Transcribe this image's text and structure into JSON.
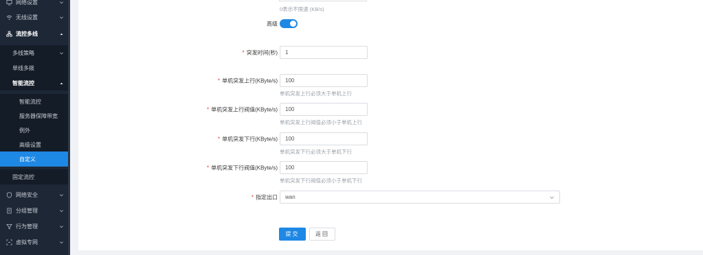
{
  "sidebar": {
    "items": [
      {
        "label": "网络设置",
        "icon": "monitor-icon"
      },
      {
        "label": "无线设置",
        "icon": "wifi-icon"
      },
      {
        "label": "流控多线",
        "icon": "network-icon"
      },
      {
        "label": "多线策略"
      },
      {
        "label": "单线多拨"
      },
      {
        "label": "智能流控"
      },
      {
        "label": "智能流控"
      },
      {
        "label": "服务器保障带宽"
      },
      {
        "label": "例外"
      },
      {
        "label": "高级设置"
      },
      {
        "label": "自定义"
      },
      {
        "label": "固定流控"
      },
      {
        "label": "网络安全",
        "icon": "shield-icon"
      },
      {
        "label": "分组管理",
        "icon": "document-icon"
      },
      {
        "label": "行为管理",
        "icon": "filter-icon"
      },
      {
        "label": "虚拟专网",
        "icon": "vpn-icon"
      }
    ]
  },
  "form": {
    "top_hint": "0表示不限速 (KB/s)",
    "advanced_label": "高级",
    "fields": [
      {
        "label": "突发时间(秒)",
        "value": "1",
        "hint": ""
      },
      {
        "label": "单机突发上行(KByte/s)",
        "value": "100",
        "hint": "单机突发上行必须大于单机上行"
      },
      {
        "label": "单机突发上行阀值(KByte/s)",
        "value": "100",
        "hint": "单机突发上行阀值必须小于单机上行"
      },
      {
        "label": "单机突发下行(KByte/s)",
        "value": "100",
        "hint": "单机突发下行必须大于单机下行"
      },
      {
        "label": "单机突发下行阀值(KByte/s)",
        "value": "100",
        "hint": "单机突发下行阀值必须小于单机下行"
      }
    ],
    "egress": {
      "label": "指定出口",
      "value": "wan"
    },
    "submit_label": "提交",
    "back_label": "返回"
  },
  "colors": {
    "accent": "#1e88e5",
    "sidebar_bg": "#1d2736",
    "required": "#e5362d"
  }
}
